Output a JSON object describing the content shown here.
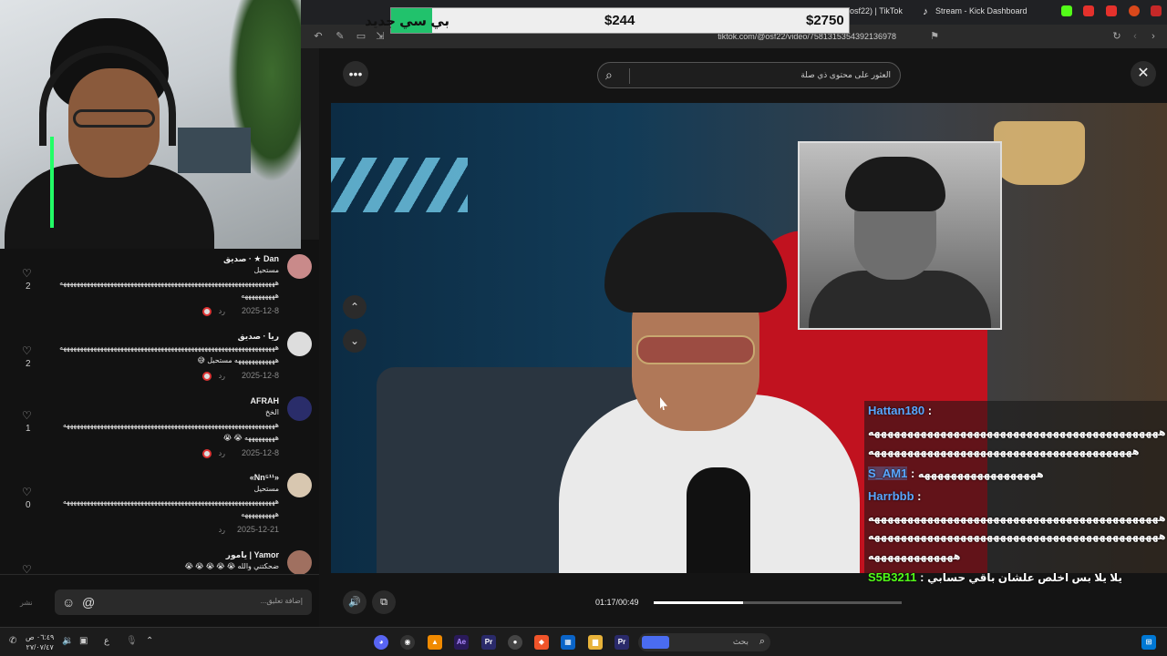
{
  "browser": {
    "tab_tiktok": "osf22) | TikTok",
    "tab_kick": "Stream - Kick Dashboard",
    "url": "tiktok.com/@osf22/video/7581315354392136978"
  },
  "donation": {
    "name": "بي سي جديد",
    "amount_small": "$244",
    "amount_large": "$2750",
    "progress_fraction": 0.09
  },
  "search": {
    "placeholder": "العثور على محتوى ذي صلة"
  },
  "comments": [
    {
      "name": "Dan ★ · صديق",
      "lines": [
        "مستحيل",
        "ههههههههههههههههههههههههههههههههههههههههههههههههههههههههههههههههه",
        "ههههههههههه"
      ],
      "date": "2025-12-8",
      "reply": "رد",
      "likes": "2",
      "avatar_color": "#c98a8a"
    },
    {
      "name": "ريا · صديق",
      "lines": [
        "ههههههههههههههههههههههههههههههههههههههههههههههههههههههههههههههههه",
        "ههههههههههههه مستحيل 😅"
      ],
      "date": "2025-12-8",
      "reply": "رد",
      "likes": "2",
      "avatar_color": "#dddddd"
    },
    {
      "name": "AFRAH",
      "lines": [
        "الخخ",
        "هههههههههههههههههههههههههههههههههههههههههههههههههههههههههههههههه",
        "هههههههههه 😭 😭"
      ],
      "date": "2025-12-8",
      "reply": "رد",
      "likes": "1",
      "avatar_color": "#2a2d6a"
    },
    {
      "name": "«Nn⁵¹¹»",
      "lines": [
        "مستحيل",
        "هههههههههههههههههههههههههههههههههههههههههههههههههههههههههههههههه",
        "ههههههههههه"
      ],
      "date": "2025-12-21",
      "reply": "رد",
      "likes": "0",
      "avatar_color": "#d8c7b0"
    },
    {
      "name": "Yamor | يامور",
      "lines": [
        "ضحكتني والله 😭 😭 😭 😭 😭"
      ],
      "date": "",
      "reply": "",
      "likes": "",
      "avatar_color": "#a07060"
    }
  ],
  "comment_box": {
    "placeholder": "إضافة تعليق...",
    "post": "نشر"
  },
  "chat": [
    {
      "user": "Hattan180",
      "sep": " :",
      "msg": ""
    },
    {
      "user": "",
      "sep": "",
      "msg": "ههههههههههههههههههههههههههههههههههههههههههههه"
    },
    {
      "user": "",
      "sep": "",
      "msg": "ههههههههههههههههههههههههههههههههههههههههه"
    },
    {
      "user": "S_AM1",
      "sep": " : ",
      "msg": "ههههههههههههههههههه"
    },
    {
      "user": "Harrbbb",
      "sep": " :",
      "msg": ""
    },
    {
      "user": "",
      "sep": "",
      "msg": "ههههههههههههههههههههههههههههههههههههههههههههه"
    },
    {
      "user": "",
      "sep": "",
      "msg": "ههههههههههههههههههههههههههههههههههههههههههههه"
    },
    {
      "user": "",
      "sep": "",
      "msg": "هههههههههههههه"
    },
    {
      "user": "S5B3211",
      "sep": " : ",
      "msg": "يلا يلا بس اخلص علشان باقي حسابي"
    }
  ],
  "video": {
    "time": "01:17/00:49",
    "progress_fraction": 0.36
  },
  "taskbar": {
    "search": "بحث",
    "time": "٠٦:٤٩ ص",
    "date": "٢٧/٠٧/٤٧",
    "lang": "ع"
  }
}
